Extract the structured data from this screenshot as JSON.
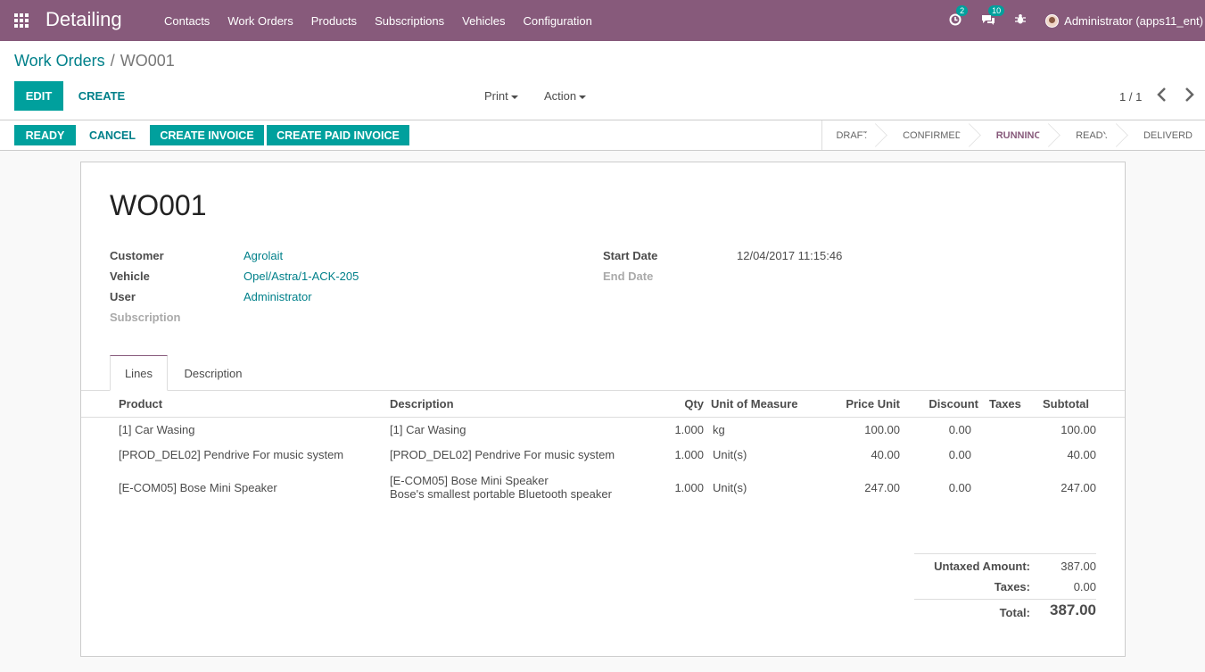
{
  "navbar": {
    "brand": "Detailing",
    "menu": [
      "Contacts",
      "Work Orders",
      "Products",
      "Subscriptions",
      "Vehicles",
      "Configuration"
    ],
    "activity_badge": "2",
    "messages_badge": "10",
    "user_label": "Administrator (apps11_ent)"
  },
  "breadcrumb": {
    "parent": "Work Orders",
    "separator": "/",
    "current": "WO001"
  },
  "controls": {
    "edit_label": "EDIT",
    "create_label": "CREATE",
    "print_label": "Print",
    "action_label": "Action",
    "pager": "1 / 1"
  },
  "statusbar": {
    "buttons": [
      "READY",
      "CANCEL",
      "CREATE INVOICE",
      "CREATE PAID INVOICE"
    ],
    "stages": [
      "DRAFT",
      "CONFIRMED",
      "RUNNING",
      "READY",
      "DELIVERD"
    ],
    "active_stage": "RUNNING"
  },
  "form": {
    "title": "WO001",
    "customer_label": "Customer",
    "customer_value": "Agrolait",
    "vehicle_label": "Vehicle",
    "vehicle_value": "Opel/Astra/1-ACK-205",
    "user_label": "User",
    "user_value": "Administrator",
    "subscription_label": "Subscription",
    "start_date_label": "Start Date",
    "start_date_value": "12/04/2017 11:15:46",
    "end_date_label": "End Date"
  },
  "tabs": [
    "Lines",
    "Description"
  ],
  "lines": {
    "headers": [
      "Product",
      "Description",
      "Qty",
      "Unit of Measure",
      "Price Unit",
      "Discount",
      "Taxes",
      "Subtotal"
    ],
    "rows": [
      {
        "product": "[1] Car Wasing",
        "description": "[1] Car Wasing",
        "description2": "",
        "qty": "1.000",
        "uom": "kg",
        "price": "100.00",
        "discount": "0.00",
        "taxes": "",
        "subtotal": "100.00"
      },
      {
        "product": "[PROD_DEL02] Pendrive For music system",
        "description": "[PROD_DEL02] Pendrive For music system",
        "description2": "",
        "qty": "1.000",
        "uom": "Unit(s)",
        "price": "40.00",
        "discount": "0.00",
        "taxes": "",
        "subtotal": "40.00"
      },
      {
        "product": "[E-COM05] Bose Mini Speaker",
        "description": "[E-COM05] Bose Mini Speaker",
        "description2": "Bose's smallest portable Bluetooth speaker",
        "qty": "1.000",
        "uom": "Unit(s)",
        "price": "247.00",
        "discount": "0.00",
        "taxes": "",
        "subtotal": "247.00"
      }
    ]
  },
  "totals": {
    "untaxed_label": "Untaxed Amount:",
    "untaxed_value": "387.00",
    "taxes_label": "Taxes:",
    "taxes_value": "0.00",
    "total_label": "Total:",
    "total_value": "387.00"
  },
  "colors": {
    "navbar": "#875a7b",
    "primary": "#00a09d",
    "link": "#00808a"
  }
}
